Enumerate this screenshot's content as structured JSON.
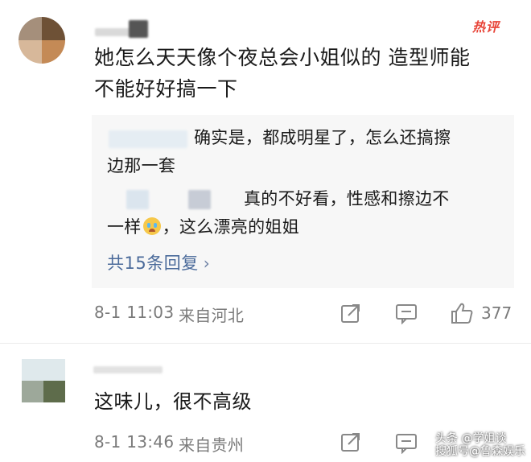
{
  "comment1": {
    "badge": "热评",
    "text_line1": "她怎么天天像个夜总会小姐似的 造型师能",
    "text_line2": "不能好好搞一下",
    "replies": [
      {
        "text_line1": "确实是，都成明星了，怎么还搞擦",
        "text_line2": "边那一套"
      },
      {
        "text_line1": "真的不好看，性感和擦边不",
        "text_line2_after_emoji": "，这么漂亮的姐姐",
        "text_line2_before_emoji": "一样"
      }
    ],
    "more_replies": "共15条回复",
    "date": "8-1 11:03",
    "location": "来自河北",
    "likes": "377"
  },
  "comment2": {
    "text": "这味儿，很不高级",
    "date": "8-1 13:46",
    "location": "来自贵州"
  },
  "watermark": {
    "line1": "头条 @学姐谈",
    "line2": "搜狐号@鲁森娱乐"
  },
  "icons": {
    "share": "share-icon",
    "comment": "comment-icon",
    "like": "thumbs-up-icon",
    "emoji": "crying-face-emoji"
  }
}
